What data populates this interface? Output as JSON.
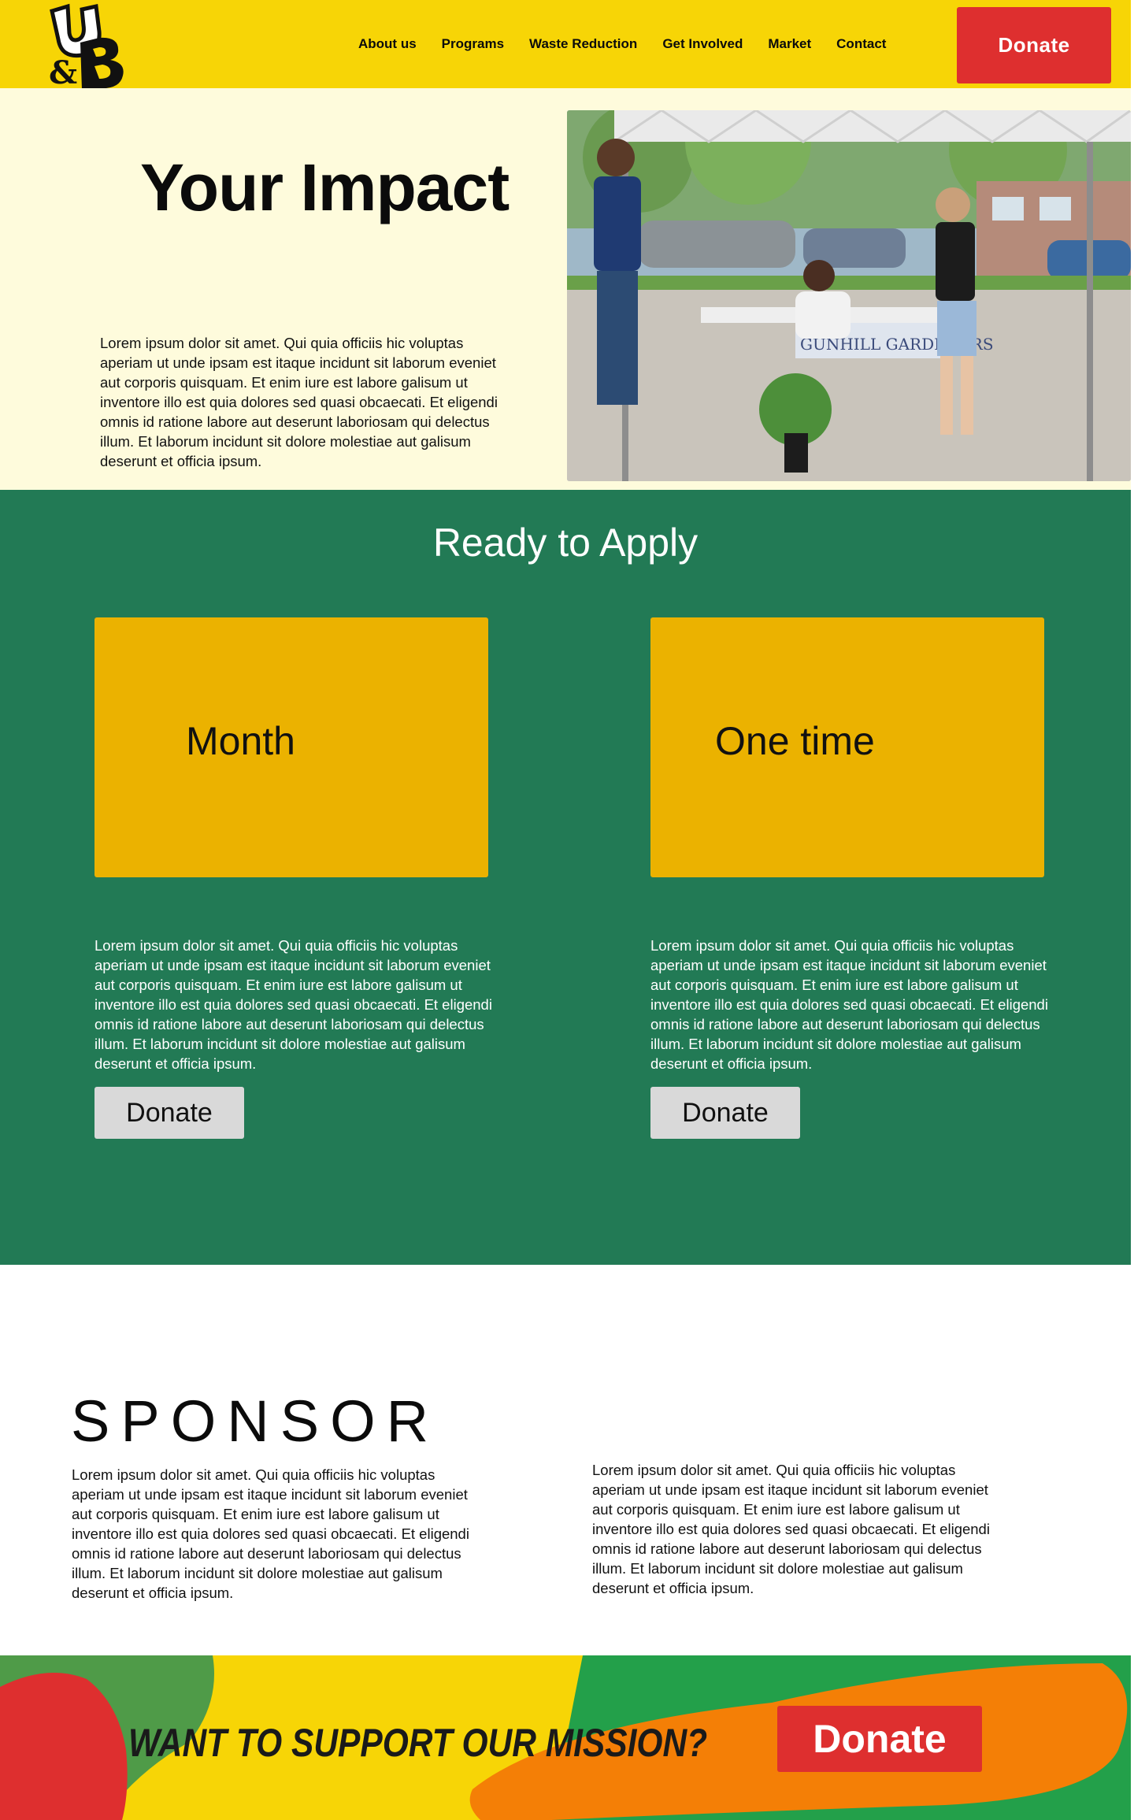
{
  "header": {
    "logo_text": "U&B",
    "nav": [
      "About us",
      "Programs",
      "Waste Reduction",
      "Get Involved",
      "Market",
      "Contact"
    ],
    "donate_label": "Donate",
    "background": "#f7d506",
    "donate_color": "#de2f2f"
  },
  "hero": {
    "title": "Your Impact",
    "text": "Lorem ipsum dolor sit amet. Qui quia officiis hic voluptas aperiam ut unde ipsam est itaque incidunt sit laborum eveniet aut corporis quisquam. Et enim iure est labore galisum ut inventore illo est quia dolores sed quasi obcaecati. Et eligendi omnis id ratione labore aut deserunt laboriosam qui delectus illum. Et laborum incidunt sit dolore molestiae aut galisum deserunt et officia ipsum.",
    "photo_banner_text": "GUNHILL GARDENERS",
    "background": "#fefbdc"
  },
  "apply": {
    "title": "Ready to Apply",
    "background": "#227a55",
    "card_color": "#ebb200",
    "plans": [
      {
        "name": "Month",
        "text": "Lorem ipsum dolor sit amet. Qui quia officiis hic voluptas aperiam ut unde ipsam est itaque incidunt sit laborum eveniet aut corporis quisquam. Et enim iure est labore galisum ut inventore illo est quia dolores sed quasi obcaecati. Et eligendi omnis id ratione labore aut deserunt laboriosam qui delectus illum. Et laborum incidunt sit dolore molestiae aut galisum deserunt et officia ipsum.",
        "donate_label": "Donate"
      },
      {
        "name": "One time",
        "text": "Lorem ipsum dolor sit amet. Qui quia officiis hic voluptas aperiam ut unde ipsam est itaque incidunt sit laborum eveniet aut corporis quisquam. Et enim iure est labore galisum ut inventore illo est quia dolores sed quasi obcaecati. Et eligendi omnis id ratione labore aut deserunt laboriosam qui delectus illum. Et laborum incidunt sit dolore molestiae aut galisum deserunt et officia ipsum.",
        "donate_label": "Donate"
      }
    ]
  },
  "sponsor": {
    "title": "SPONSOR",
    "text_left": "Lorem ipsum dolor sit amet. Qui quia officiis hic voluptas aperiam ut unde ipsam est itaque incidunt sit laborum eveniet aut corporis quisquam. Et enim iure est labore galisum ut inventore illo est quia dolores sed quasi obcaecati. Et eligendi omnis id ratione labore aut deserunt laboriosam qui delectus illum. Et laborum incidunt sit dolore molestiae aut galisum deserunt et officia ipsum.",
    "text_right": "Lorem ipsum dolor sit amet. Qui quia officiis hic voluptas aperiam ut unde ipsam est itaque incidunt sit laborum eveniet aut corporis quisquam. Et enim iure est labore galisum ut inventore illo est quia dolores sed quasi obcaecati. Et eligendi omnis id ratione labore aut deserunt laboriosam qui delectus illum. Et laborum incidunt sit dolore molestiae aut galisum deserunt et officia ipsum."
  },
  "banner": {
    "text": "WANT TO SUPPORT OUR MISSION?",
    "donate_label": "Donate",
    "colors": [
      "#4f9b48",
      "#f7d506",
      "#23a04a",
      "#f47f06",
      "#de2f2f"
    ]
  }
}
